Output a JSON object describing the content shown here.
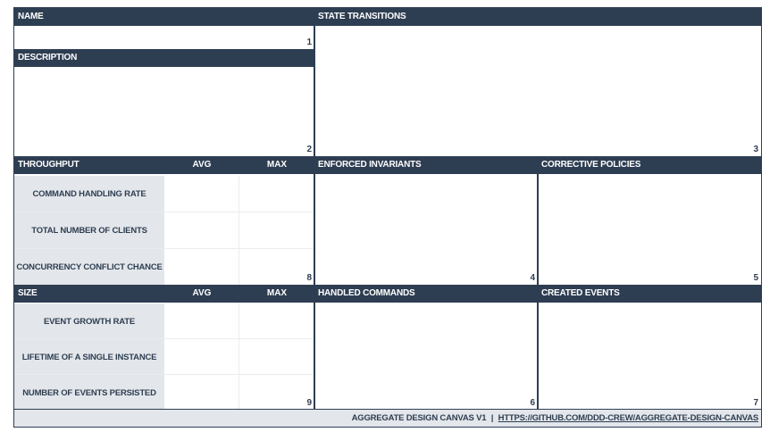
{
  "sections": {
    "name": {
      "title": "NAME",
      "number": "1"
    },
    "description": {
      "title": "DESCRIPTION",
      "number": "2"
    },
    "state_transitions": {
      "title": "STATE TRANSITIONS",
      "number": "3"
    },
    "enforced_invariants": {
      "title": "ENFORCED INVARIANTS",
      "number": "4"
    },
    "corrective_policies": {
      "title": "CORRECTIVE POLICIES",
      "number": "5"
    },
    "handled_commands": {
      "title": "HANDLED COMMANDS",
      "number": "6"
    },
    "created_events": {
      "title": "CREATED EVENTS",
      "number": "7"
    },
    "throughput": {
      "title": "THROUGHPUT",
      "number": "8",
      "col_avg": "AVG",
      "col_max": "MAX",
      "rows": [
        "COMMAND HANDLING RATE",
        "TOTAL NUMBER OF CLIENTS",
        "CONCURRENCY CONFLICT CHANCE"
      ]
    },
    "size": {
      "title": "SIZE",
      "number": "9",
      "col_avg": "AVG",
      "col_max": "MAX",
      "rows": [
        "EVENT GROWTH RATE",
        "LIFETIME OF A SINGLE INSTANCE",
        "NUMBER OF EVENTS PERSISTED"
      ]
    }
  },
  "footer": {
    "label": "AGGREGATE DESIGN CANVAS V1",
    "separator": "|",
    "link": "HTTPS://GITHUB.COM/DDD-CREW/AGGREGATE-DESIGN-CANVAS"
  },
  "colors": {
    "header": "#2e3e52",
    "label_bg": "#e3e6ea"
  }
}
